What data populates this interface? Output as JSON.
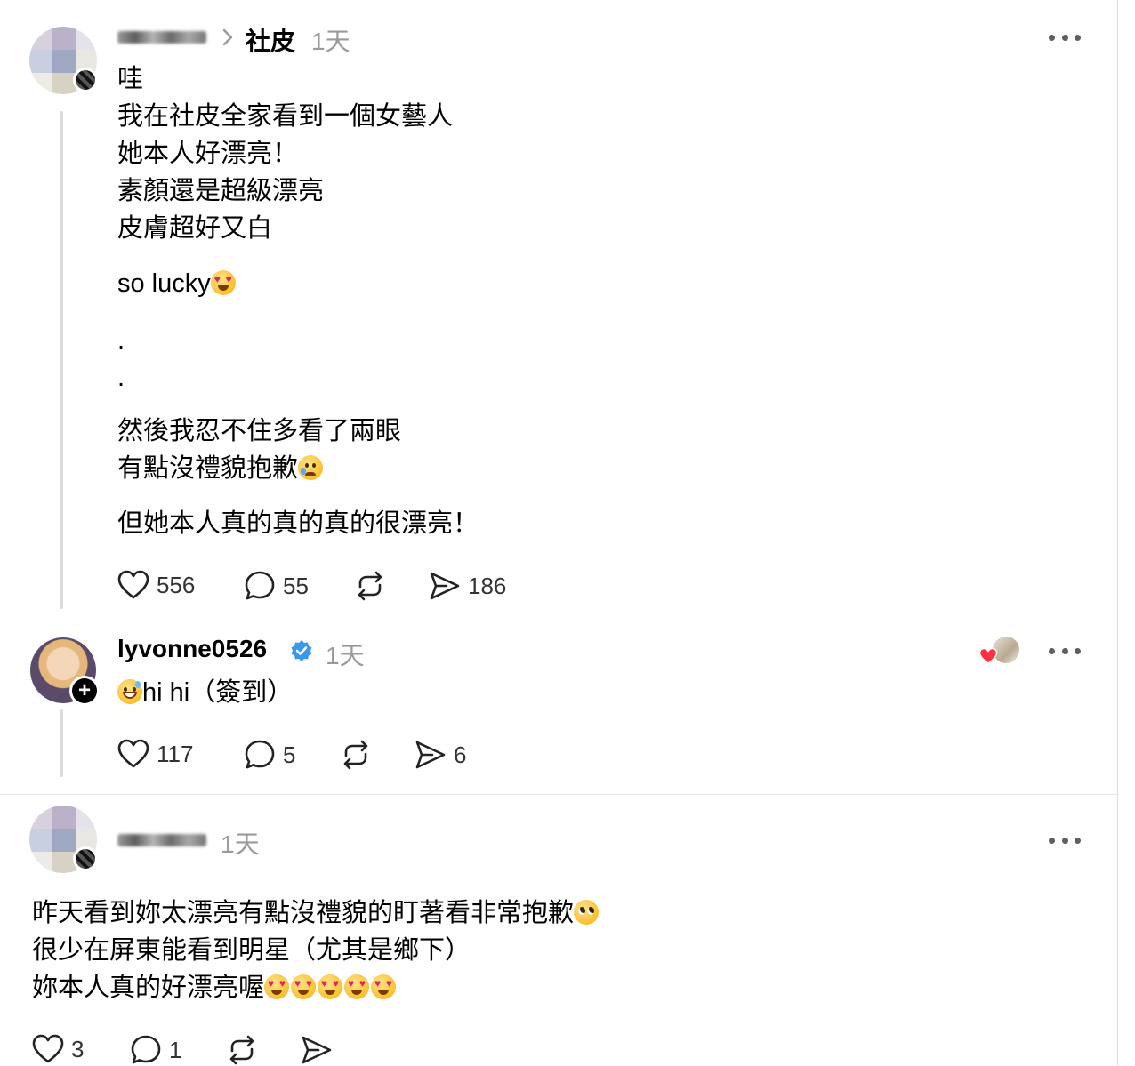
{
  "post1": {
    "username_blurred": true,
    "topic": "社皮",
    "time": "1天",
    "lines": [
      "哇",
      "我在社皮全家看到一個女藝人",
      "她本人好漂亮！",
      "素顏還是超級漂亮",
      "皮膚超好又白"
    ],
    "lucky_text": "so lucky",
    "dot1": ".",
    "dot2": ".",
    "lines2": [
      "然後我忍不住多看了兩眼",
      "有點沒禮貌抱歉"
    ],
    "closing": "但她本人真的真的真的很漂亮！",
    "likes": "556",
    "comments": "55",
    "shares": "186"
  },
  "post2": {
    "username": "lyvonne0526",
    "time": "1天",
    "text": "hi hi（簽到）",
    "likes": "117",
    "comments": "5",
    "shares": "6"
  },
  "post3": {
    "username_blurred": true,
    "time": "1天",
    "lines": [
      "昨天看到妳太漂亮有點沒禮貌的盯著看非常抱歉",
      "很少在屏東能看到明星（尤其是鄉下）",
      "妳本人真的好漂亮喔"
    ],
    "likes": "3",
    "comments": "1"
  },
  "icons": {
    "like": "heart-icon",
    "comment": "comment-bubble-icon",
    "repost": "repost-icon",
    "share": "send-icon",
    "more": "more-dots-icon",
    "verified": "verified-badge-icon",
    "follow": "follow-plus-icon"
  },
  "colors": {
    "verified": "#3897f0",
    "meta": "#9a9a9a",
    "thread_line": "#dbdbdb",
    "like_heart": "#ff3040"
  }
}
